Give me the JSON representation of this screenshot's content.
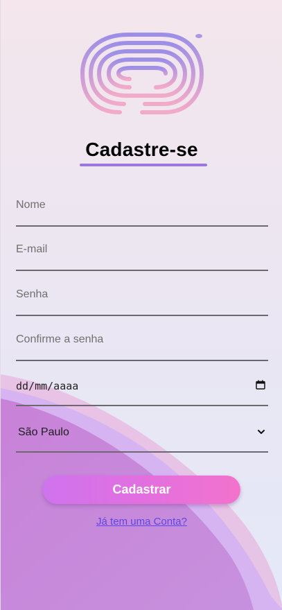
{
  "page": {
    "title": "Cadastre-se"
  },
  "form": {
    "name_placeholder": "Nome",
    "email_placeholder": "E-mail",
    "password_placeholder": "Senha",
    "confirm_password_placeholder": "Confirme a senha",
    "date_placeholder": "dd/mm/aaaa",
    "state_selected": "São Paulo"
  },
  "actions": {
    "submit_label": "Cadastrar",
    "login_link": "Já tem uma Conta?"
  },
  "icons": {
    "logo": "maze-logo-icon",
    "date": "calendar-icon",
    "select": "chevron-down-icon"
  },
  "colors": {
    "accent": "#9a78dc",
    "button_start": "#cf73ee",
    "button_end": "#f273cc",
    "link": "#5a47e6"
  }
}
